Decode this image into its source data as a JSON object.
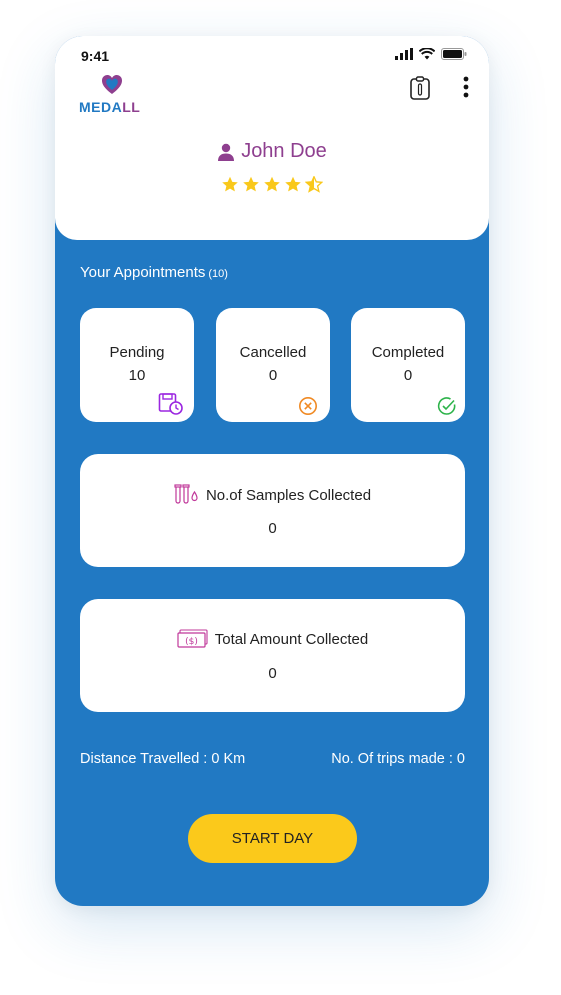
{
  "status_bar": {
    "time": "9:41"
  },
  "app": {
    "logo_text_main": "MEDA",
    "logo_text_accent": "LL",
    "brand_blue": "#2179c3",
    "brand_purple": "#8e3f8f",
    "accent_yellow": "#fbc91b"
  },
  "header": {
    "icons": [
      "clipboard-icon",
      "more-vertical-icon"
    ]
  },
  "profile": {
    "name": "John Doe",
    "rating": 4.5,
    "rating_max": 5
  },
  "appointments": {
    "title": "Your Appointments",
    "total": "(10)",
    "cards": [
      {
        "label": "Pending",
        "value": "10",
        "icon": "calendar-clock-icon",
        "color": "#9b27e0"
      },
      {
        "label": "Cancelled",
        "value": "0",
        "icon": "x-circle-icon",
        "color": "#f08a24"
      },
      {
        "label": "Completed",
        "value": "0",
        "icon": "check-circle-icon",
        "color": "#2db34a"
      }
    ]
  },
  "samples": {
    "label": "No.of Samples Collected",
    "value": "0",
    "icon": "test-tubes-icon"
  },
  "amount": {
    "label": "Total Amount Collected",
    "value": "0",
    "icon": "cash-icon"
  },
  "stats": {
    "distance": "Distance Travelled : 0 Km",
    "trips": "No. Of trips made : 0"
  },
  "start_button": {
    "label": "START DAY"
  }
}
